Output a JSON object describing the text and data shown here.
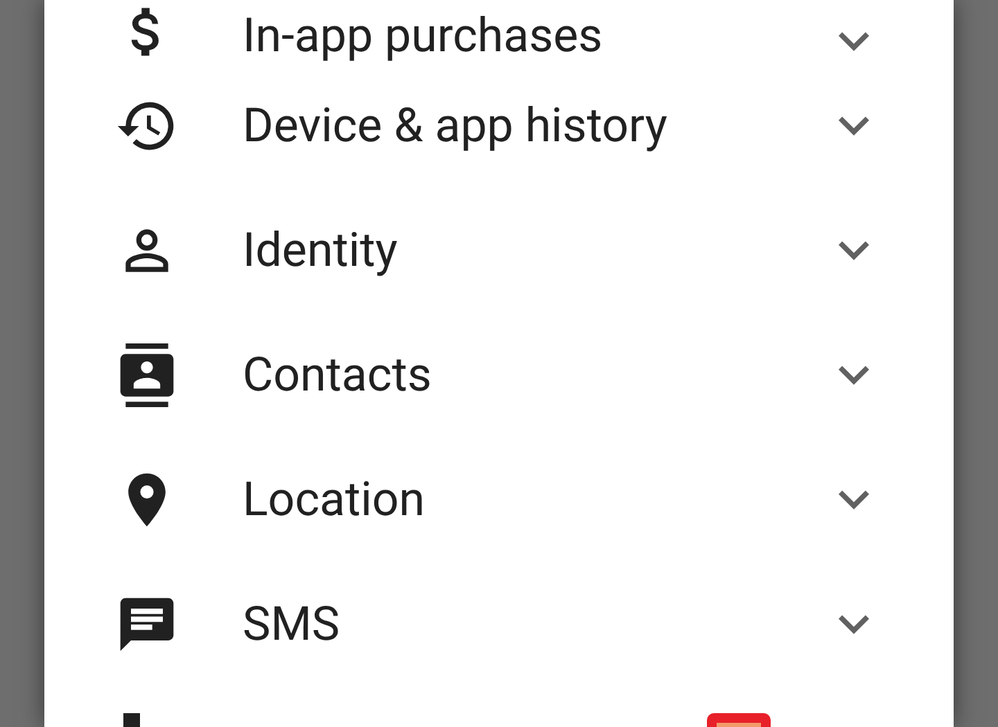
{
  "permissions": [
    {
      "label": "In-app purchases",
      "expanded": false
    },
    {
      "label": "Device & app history",
      "expanded": false
    },
    {
      "label": "Identity",
      "expanded": false
    },
    {
      "label": "Contacts",
      "expanded": false
    },
    {
      "label": "Location",
      "expanded": false
    },
    {
      "label": "SMS",
      "expanded": false
    }
  ]
}
